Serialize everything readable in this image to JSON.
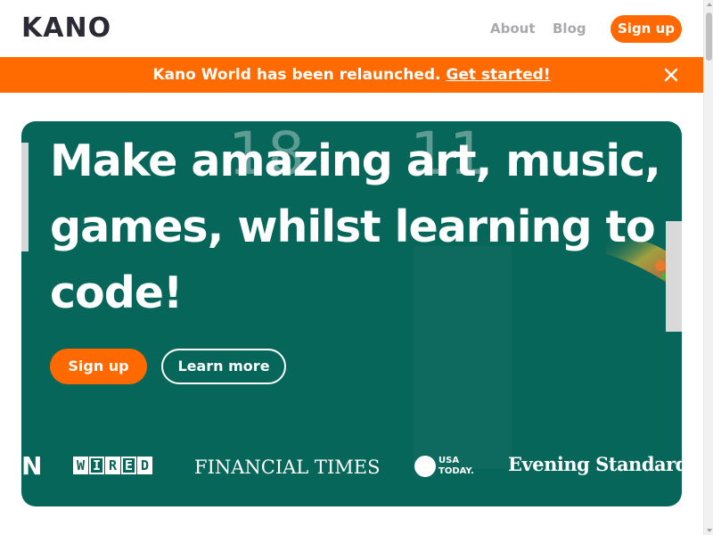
{
  "header": {
    "logo": "KANO",
    "nav": [
      {
        "label": "About"
      },
      {
        "label": "Blog"
      }
    ],
    "signup_label": "Sign up"
  },
  "banner": {
    "text": "Kano World has been relaunched.",
    "link_label": "Get started!"
  },
  "hero": {
    "ghost_numbers": [
      "18",
      "11"
    ],
    "headline": "Make amazing art, music, games, whilst learning to code!",
    "signup_label": "Sign up",
    "learn_more_label": "Learn more"
  },
  "press": {
    "partial_logo": "N",
    "wired": [
      "W",
      "I",
      "R",
      "E",
      "D"
    ],
    "financial_times": "FINANCIAL TIMES",
    "usa_today_line1": "USA",
    "usa_today_line2": "TODAY.",
    "evening_standard": "Evening Standard"
  },
  "colors": {
    "brand_orange": "#ff6900",
    "hero_green": "#07665a",
    "logo_dark": "#2b2b35",
    "nav_grey": "#a9a9ad"
  }
}
